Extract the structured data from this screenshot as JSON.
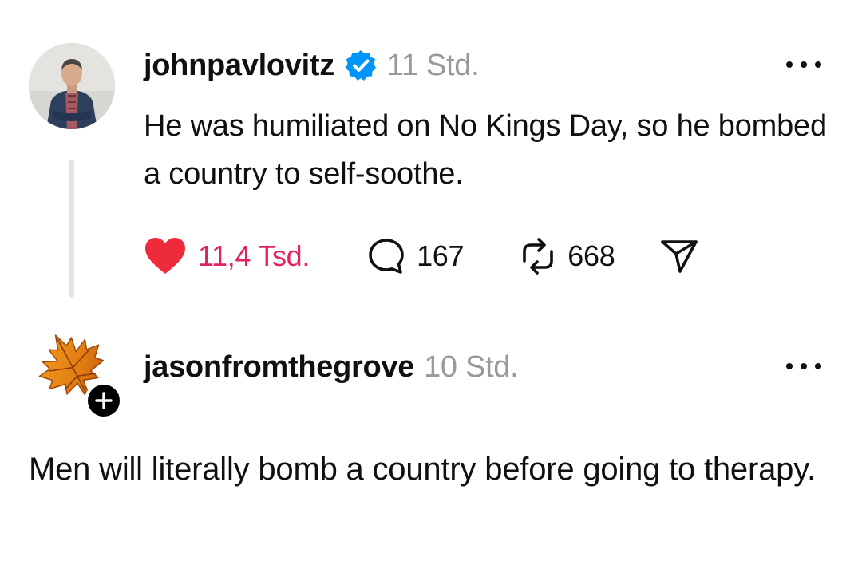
{
  "post1": {
    "username": "johnpavlovitz",
    "verified": true,
    "timestamp": "11 Std.",
    "text": "He was humiliated on No Kings Day, so he bombed a country to self-soothe.",
    "likes": "11,4 Tsd.",
    "replies": "167",
    "reposts": "668",
    "liked": true
  },
  "post2": {
    "username": "jasonfromthegrove",
    "timestamp": "10 Std.",
    "text": "Men will literally bomb a country before going to therapy."
  },
  "colors": {
    "like_red": "#e0245e",
    "verified_blue": "#0095f6",
    "muted_gray": "#999999",
    "text": "#101010"
  },
  "icons": {
    "verified": "verified-badge-icon",
    "more": "ellipsis-icon",
    "like": "heart-icon",
    "reply": "speech-bubble-icon",
    "repost": "repost-arrows-icon",
    "share": "paper-plane-icon",
    "follow": "plus-icon"
  }
}
